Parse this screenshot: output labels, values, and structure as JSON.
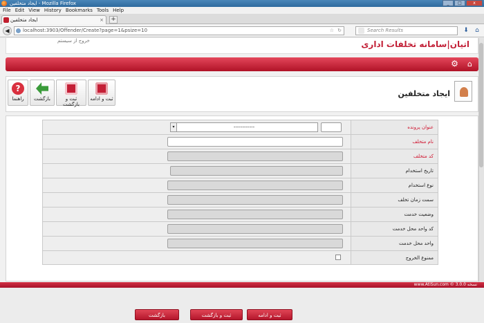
{
  "window": {
    "title": "ایجاد متخلفین - Mozilla Firefox"
  },
  "menu": [
    "File",
    "Edit",
    "View",
    "History",
    "Bookmarks",
    "Tools",
    "Help"
  ],
  "tab": {
    "title": "ایجاد متخلفین"
  },
  "nav": {
    "url": "localhost:3903/Offender/Create?page=1&psize=10",
    "search_placeholder": "Search Results"
  },
  "banner": {
    "brand": "اتیان|سامانه تخلفات اداری",
    "logout": "خروج از سیستم"
  },
  "toolbar": {
    "save_continue": "ثبت و ادامه",
    "save_back": "ثبت و بازگشت",
    "back": "بازگشت",
    "help": "راهنما"
  },
  "page_title": "ایجاد متخلفین",
  "form": {
    "fields": [
      {
        "label": "عنوان پرونده",
        "required": true
      },
      {
        "label": "نام متخلف",
        "required": true
      },
      {
        "label": "کد متخلف",
        "required": true
      },
      {
        "label": "تاریخ استخدام",
        "required": false
      },
      {
        "label": "نوع استخدام",
        "required": false
      },
      {
        "label": "سمت زمان تخلف",
        "required": false
      },
      {
        "label": "وضعیت خدمت",
        "required": false
      },
      {
        "label": "کد واحد محل خدمت",
        "required": false
      },
      {
        "label": "واحد محل خدمت",
        "required": false
      },
      {
        "label": "ممنوع الخروج",
        "required": false
      }
    ],
    "case_select_value": "------------"
  },
  "actions": {
    "save_continue": "ثبت و ادامه",
    "save_back": "ثبت و بازگشت",
    "back": "بازگشت"
  },
  "footer": {
    "text": "www.AtiSun.com © نسخه 3.0.0"
  }
}
